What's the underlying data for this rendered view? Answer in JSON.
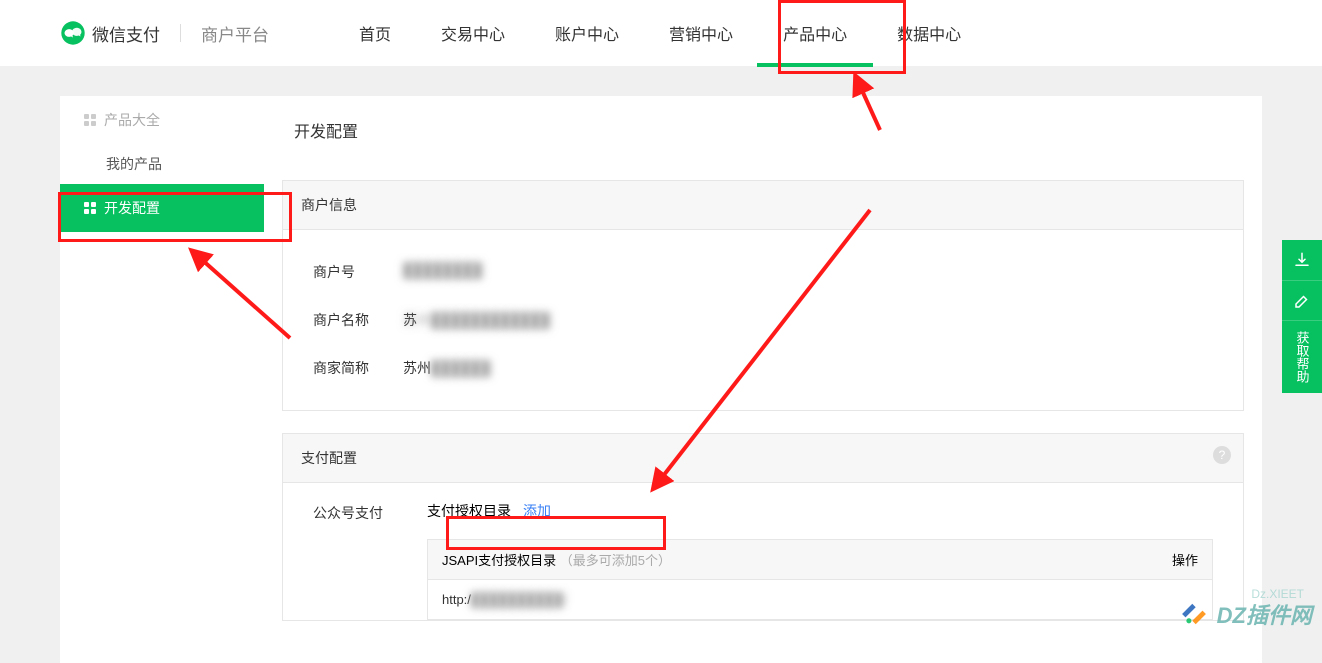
{
  "header": {
    "brand": "微信支付",
    "sub": "商户平台",
    "nav": [
      "首页",
      "交易中心",
      "账户中心",
      "营销中心",
      "产品中心",
      "数据中心"
    ],
    "active_index": 4
  },
  "sidebar": {
    "category": "产品大全",
    "sub_item": "我的产品",
    "active_item": "开发配置"
  },
  "page": {
    "title": "开发配置"
  },
  "merchant_panel": {
    "title": "商户信息",
    "rows": [
      {
        "label": "商户号",
        "value": "████████"
      },
      {
        "label": "商户名称",
        "value": "苏州████████████"
      },
      {
        "label": "商家简称",
        "value": "苏州██████"
      }
    ]
  },
  "pay_panel": {
    "title": "支付配置",
    "left_label": "公众号支付",
    "auth_label": "支付授权目录",
    "add_label": "添加",
    "jsapi_title": "JSAPI支付授权目录",
    "jsapi_hint": "（最多可添加5个）",
    "op_col": "操作",
    "entry_prefix": "http:/",
    "entry_blur": "██████████/"
  },
  "right_tools": {
    "help": "获取帮助"
  },
  "watermark": {
    "text": "DZ插件网",
    "sub": "Dz.XIEET"
  }
}
